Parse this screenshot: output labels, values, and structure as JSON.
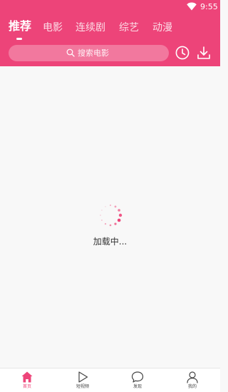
{
  "status_bar": {
    "time": "9:55",
    "wifi_icon": "wifi-icon"
  },
  "tabs": [
    {
      "label": "推荐",
      "active": true
    },
    {
      "label": "电影",
      "active": false
    },
    {
      "label": "连续剧",
      "active": false
    },
    {
      "label": "综艺",
      "active": false
    },
    {
      "label": "动漫",
      "active": false
    }
  ],
  "search": {
    "placeholder": "搜索电影",
    "icon": "search-icon"
  },
  "header_actions": {
    "history_icon": "clock-icon",
    "download_icon": "download-icon"
  },
  "loading": {
    "text": "加载中..."
  },
  "bottom_nav": [
    {
      "label": "首页",
      "icon": "home-icon",
      "active": true
    },
    {
      "label": "短视频",
      "icon": "play-icon",
      "active": false
    },
    {
      "label": "发现",
      "icon": "chat-bubble-icon",
      "active": false
    },
    {
      "label": "我的",
      "icon": "user-icon",
      "active": false
    }
  ],
  "colors": {
    "accent": "#ed4479",
    "background": "#f8f8f8",
    "text": "#333333"
  }
}
